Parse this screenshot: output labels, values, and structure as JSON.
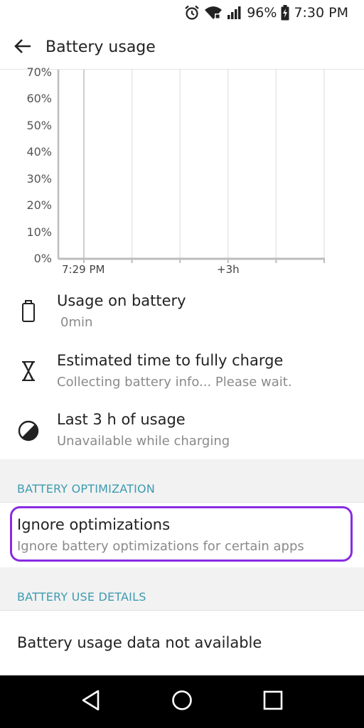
{
  "status": {
    "battery_percent": "96%",
    "time": "7:30 PM",
    "icons": [
      "alarm-icon",
      "wifi-icon",
      "signal-icon",
      "battery-charging-icon"
    ]
  },
  "app_bar": {
    "title": "Battery usage",
    "back_icon": "arrow-left-icon"
  },
  "chart_data": {
    "type": "line",
    "title": "",
    "xlabel": "",
    "ylabel": "",
    "y_ticks": [
      "70%",
      "60%",
      "50%",
      "40%",
      "30%",
      "20%",
      "10%",
      "0%"
    ],
    "x_ticks": [
      "7:29 PM",
      "+3h"
    ],
    "ylim": [
      0,
      70
    ],
    "grid": true,
    "series": []
  },
  "usage_items": [
    {
      "icon": "battery-icon",
      "title": "Usage on battery",
      "subtitle": "0min"
    },
    {
      "icon": "hourglass-icon",
      "title": "Estimated time to fully charge",
      "subtitle": "Collecting battery info... Please wait."
    },
    {
      "icon": "half-circle-icon",
      "title": "Last 3 h of usage",
      "subtitle": "Unavailable while charging"
    }
  ],
  "battery_optimization": {
    "header": "BATTERY OPTIMIZATION",
    "title": "Ignore optimizations",
    "subtitle": "Ignore battery optimizations for certain apps",
    "highlight_color": "#8a2be2"
  },
  "battery_use_details": {
    "header": "BATTERY USE DETAILS",
    "message": "Battery usage data not available"
  },
  "nav": {
    "icons": [
      "back-triangle-icon",
      "home-circle-icon",
      "recents-square-icon"
    ]
  },
  "colors": {
    "section_header": "#3d9bb0",
    "subtitle": "#8a8a8a",
    "section_gap": "#f2f2f2"
  }
}
